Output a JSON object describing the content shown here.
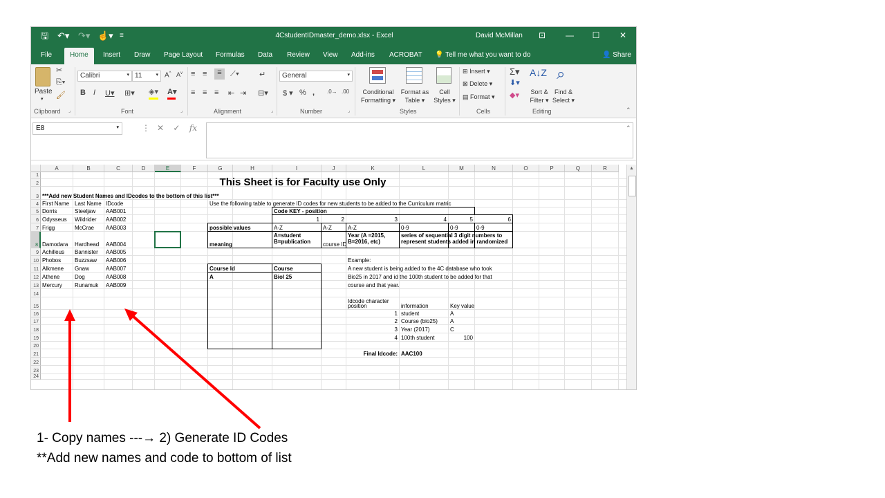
{
  "window": {
    "title": "4CstudentIDmaster_demo.xlsx  -  Excel",
    "user": "David McMillan"
  },
  "tabs": [
    "File",
    "Home",
    "Insert",
    "Draw",
    "Page Layout",
    "Formulas",
    "Data",
    "Review",
    "View",
    "Add-ins",
    "ACROBAT"
  ],
  "tell_me": "Tell me what you want to do",
  "share": "Share",
  "ribbon": {
    "paste": "Paste",
    "font_name": "Calibri",
    "font_size": "11",
    "number_format": "General",
    "conditional_formatting": [
      "Conditional",
      "Formatting"
    ],
    "format_as_table": [
      "Format as",
      "Table"
    ],
    "cell_styles": [
      "Cell",
      "Styles"
    ],
    "insert": "Insert",
    "delete": "Delete",
    "format": "Format",
    "sort_filter": [
      "Sort &",
      "Filter"
    ],
    "find_select": [
      "Find &",
      "Select"
    ],
    "groups": [
      "Clipboard",
      "Font",
      "Alignment",
      "Number",
      "Styles",
      "Cells",
      "Editing"
    ]
  },
  "formula_bar": {
    "name_box": "E8",
    "formula": ""
  },
  "sheet": {
    "columns": [
      "A",
      "B",
      "C",
      "D",
      "E",
      "F",
      "G",
      "H",
      "I",
      "J",
      "K",
      "L",
      "M",
      "N",
      "O",
      "P",
      "Q",
      "R"
    ],
    "rows": [
      "1",
      "2",
      "3",
      "4",
      "5",
      "6",
      "7",
      "8",
      "9",
      "10",
      "11",
      "12",
      "13",
      "14",
      "15",
      "16",
      "17",
      "18",
      "19",
      "20",
      "21",
      "22",
      "23",
      "24"
    ],
    "title": "This Sheet is for Faculty use Only",
    "instruction": "***Add new Student Names and IDcodes to the bottom of this list***",
    "headers": [
      "First Name",
      "Last Name",
      "IDcode"
    ],
    "students": [
      [
        "Dorris",
        "Steeljaw",
        "AAB001"
      ],
      [
        "Odysseus",
        "Wildrider",
        "AAB002"
      ],
      [
        "Frigg",
        "McCrae",
        "AAB003"
      ],
      [
        "Damodara",
        "Hardhead",
        "AAB004"
      ],
      [
        "Achilleus",
        "Bannister",
        "AAB005"
      ],
      [
        "Phobos",
        "Buzzsaw",
        "AAB006"
      ],
      [
        "Alkmene",
        "Gnaw",
        "AAB007"
      ],
      [
        "Athene",
        "Dog",
        "AAB008"
      ],
      [
        "Mercury",
        "Runamuk",
        "AAB009"
      ]
    ],
    "key_intro": "Use the following table to generate ID codes for new students to be added to the Curriculum matric",
    "code_key_title": "Code KEY - position",
    "positions": [
      "1",
      "2",
      "3",
      "4",
      "5",
      "6"
    ],
    "possible_values_label": "possible values",
    "possible_values": [
      "A-Z",
      "A-Z",
      "A-Z",
      "0-9",
      "0-9",
      "0-9"
    ],
    "meaning_label": "meaning",
    "meaning_h": "A=student\nB=publication",
    "meaning_i": "course ID",
    "meaning_j": "Year (A =2015,\nB=2016, etc)",
    "meaning_k": "series of sequential 3 digit numbers to\nrepresent students added in randomized",
    "course_id_header": "Course Id",
    "course_header": "Course",
    "course_id": "A",
    "course": "Biol 25",
    "example_label": "Example:",
    "example_lines": [
      "A new student is being added to the 4C database who took",
      "Bio25 in 2017 and id the 100th student to be added for that",
      "course and that year."
    ],
    "idcode_char_header": [
      "Idcode character",
      "position"
    ],
    "information_header": "information",
    "key_value_header": "Key value",
    "example_rows": [
      [
        "1",
        "student",
        "A"
      ],
      [
        "2",
        "Course (bio25)",
        "A"
      ],
      [
        "3",
        "Year (2017)",
        "C"
      ],
      [
        "4",
        "100th student",
        "100"
      ]
    ],
    "final_idcode_label": "Final Idcode:",
    "final_idcode": "AAC100"
  },
  "annotation": {
    "line1_left": "1- Copy names  ---",
    "arrow_glyph": "→",
    "line1_right": "  2) Generate ID Codes",
    "line2": "**Add new names and code to bottom of list"
  },
  "colors": {
    "excel_green": "#217346",
    "arrow_red": "#ff0000",
    "selection": "#217346"
  }
}
